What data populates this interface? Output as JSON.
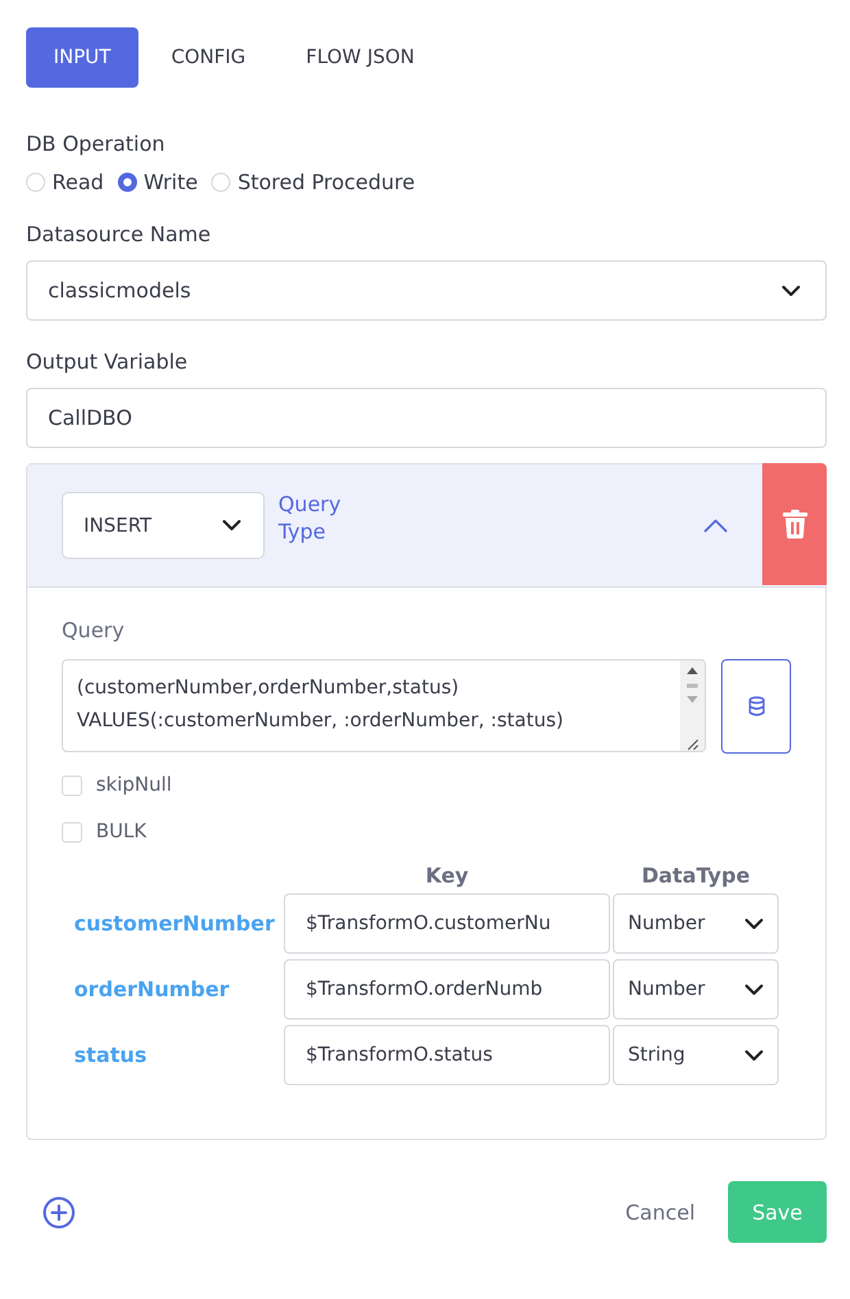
{
  "tabs": [
    {
      "label": "INPUT",
      "selected": true
    },
    {
      "label": "CONFIG",
      "selected": false
    },
    {
      "label": "FLOW JSON",
      "selected": false
    }
  ],
  "db_operation": {
    "label": "DB Operation",
    "options": [
      {
        "label": "Read",
        "selected": false
      },
      {
        "label": "Write",
        "selected": true
      },
      {
        "label": "Stored Procedure",
        "selected": false
      }
    ]
  },
  "datasource": {
    "label": "Datasource Name",
    "value": "classicmodels"
  },
  "output_variable": {
    "label": "Output Variable",
    "value": "CallDBO"
  },
  "query_block": {
    "query_type": "INSERT",
    "query_type_label": "Query Type",
    "expanded": true,
    "query": {
      "label": "Query",
      "lines": [
        "(customerNumber,orderNumber,status)",
        "VALUES(:customerNumber, :orderNumber, :status)"
      ]
    },
    "options": [
      {
        "label": "skipNull",
        "checked": false
      },
      {
        "label": "BULK",
        "checked": false
      }
    ],
    "columns": [
      "Key",
      "DataType"
    ],
    "rows": [
      {
        "name": "customerNumber",
        "key": "$TransformO.customerNu",
        "datatype": "Number"
      },
      {
        "name": "orderNumber",
        "key": "$TransformO.orderNumb",
        "datatype": "Number"
      },
      {
        "name": "status",
        "key": "$TransformO.status",
        "datatype": "String"
      }
    ]
  },
  "footer": {
    "cancel": "Cancel",
    "save": "Save"
  }
}
